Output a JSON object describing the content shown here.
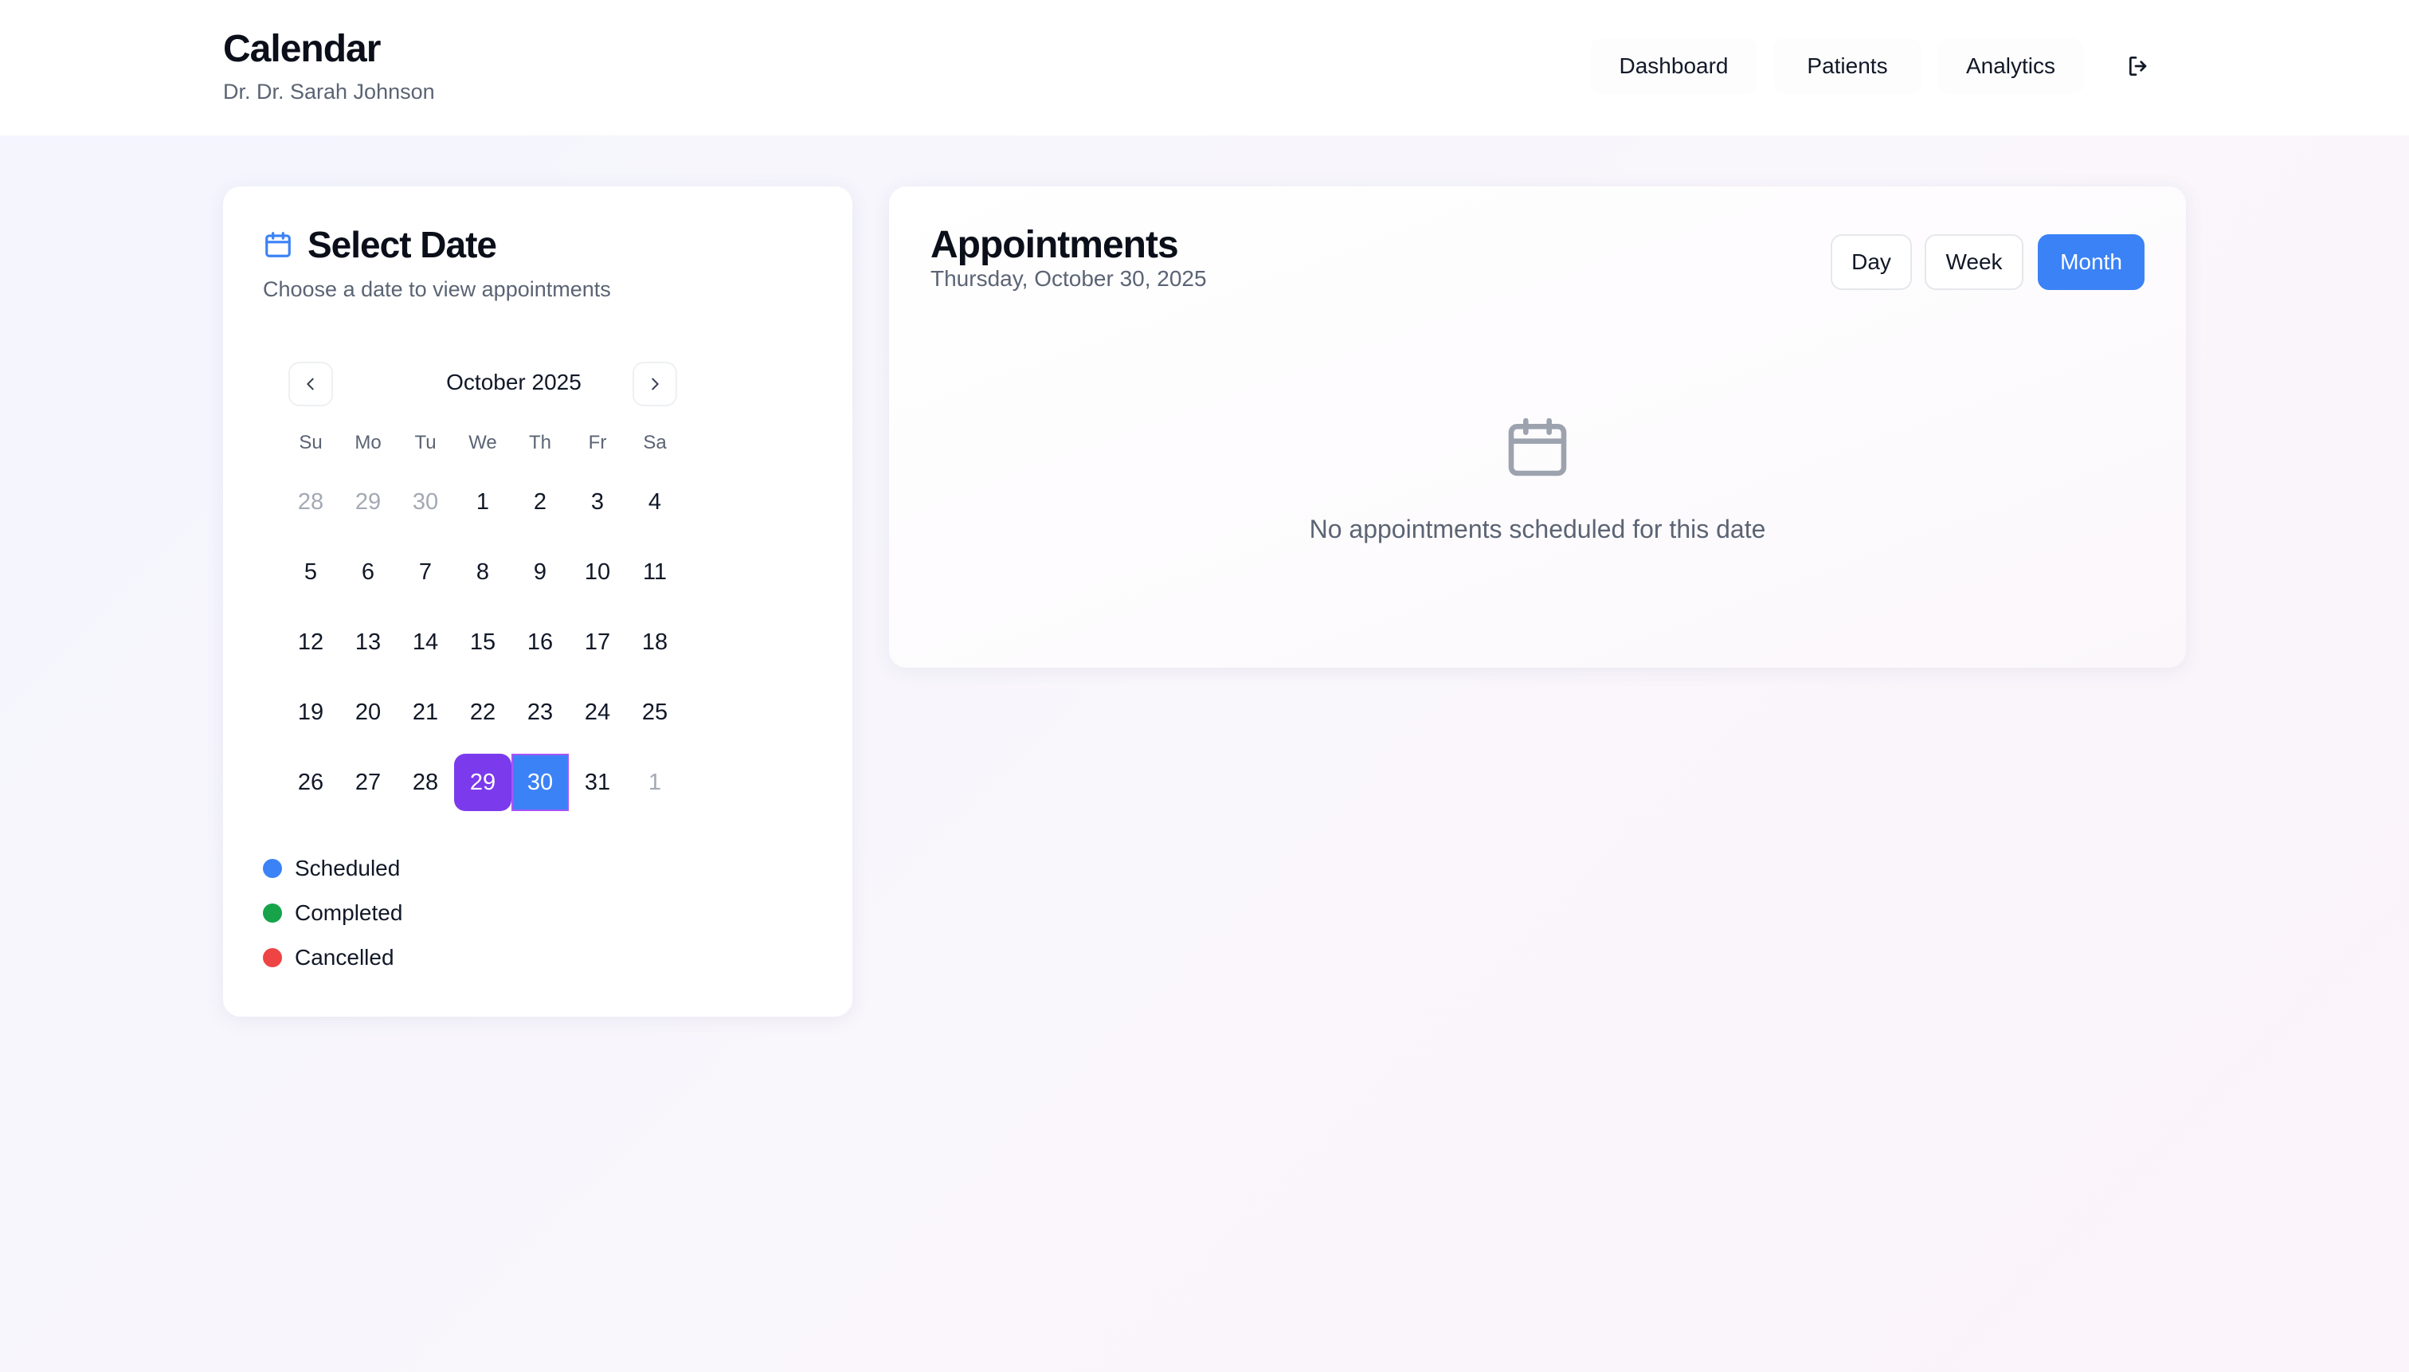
{
  "header": {
    "title": "Calendar",
    "subtitle": "Dr. Dr. Sarah Johnson",
    "nav": [
      {
        "label": "Dashboard"
      },
      {
        "label": "Patients"
      },
      {
        "label": "Analytics"
      }
    ],
    "logout_icon": "logout-icon"
  },
  "select_date": {
    "title": "Select Date",
    "subtitle": "Choose a date to view appointments",
    "icon": "calendar-icon",
    "calendar": {
      "month_label": "October 2025",
      "weekdays": [
        "Su",
        "Mo",
        "Tu",
        "We",
        "Th",
        "Fr",
        "Sa"
      ],
      "weeks": [
        [
          "28",
          "29",
          "30",
          "1",
          "2",
          "3",
          "4"
        ],
        [
          "5",
          "6",
          "7",
          "8",
          "9",
          "10",
          "11"
        ],
        [
          "12",
          "13",
          "14",
          "15",
          "16",
          "17",
          "18"
        ],
        [
          "19",
          "20",
          "21",
          "22",
          "23",
          "24",
          "25"
        ],
        [
          "26",
          "27",
          "28",
          "29",
          "30",
          "31",
          "1"
        ]
      ],
      "today": "29",
      "selected": "30"
    },
    "legend": [
      {
        "label": "Scheduled",
        "color": "#3b82f6"
      },
      {
        "label": "Completed",
        "color": "#16a34a"
      },
      {
        "label": "Cancelled",
        "color": "#ef4444"
      }
    ]
  },
  "appointments": {
    "title": "Appointments",
    "date": "Thursday, October 30, 2025",
    "views": [
      {
        "label": "Day",
        "active": false
      },
      {
        "label": "Week",
        "active": false
      },
      {
        "label": "Month",
        "active": true
      }
    ],
    "empty_icon": "calendar-icon",
    "empty_message": "No appointments scheduled for this date"
  },
  "colors": {
    "accent": "#3b82f6",
    "today": "#7c3aed"
  }
}
